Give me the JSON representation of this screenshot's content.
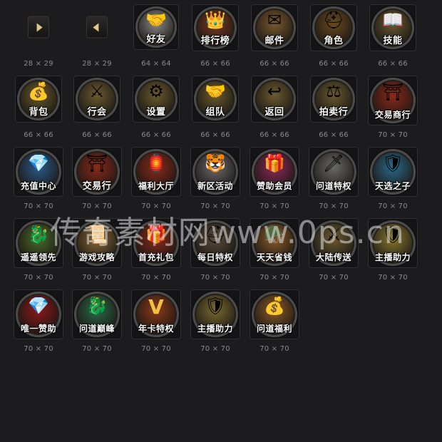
{
  "watermark": "传奇素材网www.0ps.cn",
  "icons": [
    {
      "id": "arrow-right",
      "label": "",
      "size": "28 × 29",
      "glyph": "",
      "color": "#e0c78a"
    },
    {
      "id": "arrow-left",
      "label": "",
      "size": "28 × 29",
      "glyph": "",
      "color": "#e0c78a"
    },
    {
      "id": "friends",
      "label": "好友",
      "size": "64 × 64",
      "glyph": "🤝",
      "color": "#8a8a8a"
    },
    {
      "id": "ranking",
      "label": "排行榜",
      "size": "66 × 66",
      "glyph": "👑",
      "color": "#7a3a20"
    },
    {
      "id": "mail",
      "label": "邮件",
      "size": "66 × 66",
      "glyph": "✉",
      "color": "#7a5a30"
    },
    {
      "id": "character",
      "label": "角色",
      "size": "66 × 66",
      "glyph": "⛑",
      "color": "#6a4a20"
    },
    {
      "id": "skills",
      "label": "技能",
      "size": "66 × 66",
      "glyph": "📖",
      "color": "#6a5a30"
    },
    {
      "id": "bag",
      "label": "背包",
      "size": "66 × 66",
      "glyph": "💰",
      "color": "#6a5a30"
    },
    {
      "id": "guild",
      "label": "行会",
      "size": "66 × 66",
      "glyph": "⚔",
      "color": "#6a5a30"
    },
    {
      "id": "settings",
      "label": "设置",
      "size": "66 × 66",
      "glyph": "⚙",
      "color": "#6a5a30"
    },
    {
      "id": "team",
      "label": "组队",
      "size": "66 × 66",
      "glyph": "🤝",
      "color": "#6a5a30"
    },
    {
      "id": "back",
      "label": "返回",
      "size": "66 × 66",
      "glyph": "↩",
      "color": "#6a5a30"
    },
    {
      "id": "auction",
      "label": "拍卖行",
      "size": "66 × 66",
      "glyph": "⚖",
      "color": "#6a5a30"
    },
    {
      "id": "trade-shop",
      "label": "交易商行",
      "size": "70 × 70",
      "glyph": "⛩",
      "color": "#8a2a1a"
    },
    {
      "id": "recharge",
      "label": "充值中心",
      "size": "70 × 70",
      "glyph": "💎",
      "color": "#2a5a8a"
    },
    {
      "id": "trade",
      "label": "交易行",
      "size": "70 × 70",
      "glyph": "⛩",
      "color": "#8a2a1a"
    },
    {
      "id": "welfare-hall",
      "label": "福利大厅",
      "size": "70 × 70",
      "glyph": "🏮",
      "color": "#8a2a1a"
    },
    {
      "id": "new-zone-events",
      "label": "新区活动",
      "size": "70 × 70",
      "glyph": "🐯",
      "color": "#6a6a6a"
    },
    {
      "id": "sponsor-member",
      "label": "赞助会员",
      "size": "70 × 70",
      "glyph": "🎁",
      "color": "#8a2a5a"
    },
    {
      "id": "wendao-privilege",
      "label": "问道特权",
      "size": "70 × 70",
      "glyph": "🗡",
      "color": "#6a6a6a"
    },
    {
      "id": "chosen-one",
      "label": "天选之子",
      "size": "70 × 70",
      "glyph": "🛡",
      "color": "#2a6a8a"
    },
    {
      "id": "far-ahead",
      "label": "遥遥领先",
      "size": "70 × 70",
      "glyph": "🐉",
      "color": "#4a6a2a"
    },
    {
      "id": "game-guide",
      "label": "游戏攻略",
      "size": "70 × 70",
      "glyph": "📜",
      "color": "#8a6a3a"
    },
    {
      "id": "first-recharge-gift",
      "label": "首充礼包",
      "size": "70 × 70",
      "glyph": "🎁",
      "color": "#8a2a1a"
    },
    {
      "id": "daily-privilege",
      "label": "每日特权",
      "size": "70 × 70",
      "glyph": "⛑",
      "color": "#5a4a3a"
    },
    {
      "id": "daily-savings",
      "label": "天天省钱",
      "size": "70 × 70",
      "glyph": "🪖",
      "color": "#8a5a2a"
    },
    {
      "id": "continent-teleport",
      "label": "大陆传送",
      "size": "70 × 70",
      "glyph": "⚔",
      "color": "#6a5a30"
    },
    {
      "id": "streamer-assist-1",
      "label": "主播助力",
      "size": "70 × 70",
      "glyph": "🛡",
      "color": "#8a7a30"
    },
    {
      "id": "sole-sponsor",
      "label": "唯一赞助",
      "size": "70 × 70",
      "glyph": "💎",
      "color": "#8a1a1a"
    },
    {
      "id": "wendao-peak",
      "label": "问道巅峰",
      "size": "70 × 70",
      "glyph": "🐉",
      "color": "#2a6a4a"
    },
    {
      "id": "annual-card",
      "label": "年卡特权",
      "size": "70 × 70",
      "glyph": "V",
      "color": "#8a3a1a"
    },
    {
      "id": "streamer-assist-2",
      "label": "主播助力",
      "size": "70 × 70",
      "glyph": "🛡",
      "color": "#7a6a30"
    },
    {
      "id": "wendao-welfare",
      "label": "问道福利",
      "size": "70 × 70",
      "glyph": "💰",
      "color": "#8a5a2a"
    }
  ]
}
